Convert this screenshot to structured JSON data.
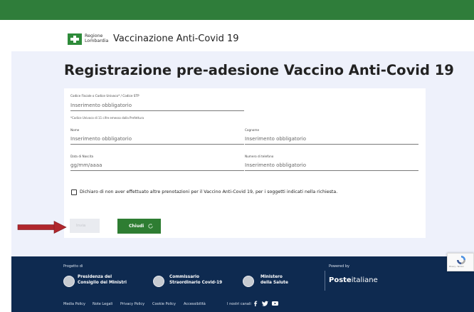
{
  "header": {
    "logo_line1": "Regione",
    "logo_line2": "Lombardia",
    "title": "Vaccinazione Anti-Covid 19"
  },
  "main": {
    "title": "Registrazione pre-adesione Vaccino Anti-Covid 19"
  },
  "form": {
    "codice_label": "Codice Fiscale o Codice Univoco* / Codice STP",
    "codice_placeholder": "Inserimento obbligatorio",
    "codice_hint": "*Codice Univoco di 11 cifre emesso dalla Prefettura",
    "nome_label": "Nome",
    "nome_placeholder": "Inserimento obbligatorio",
    "cognome_label": "Cognome",
    "cognome_placeholder": "Inserimento obbligatorio",
    "data_label": "Data di Nascita",
    "data_placeholder": "gg/mm/aaaa",
    "telefono_label": "Numero di telefono",
    "telefono_placeholder": "Inserimento obbligatorio",
    "checkbox_label": "Dichiaro di non aver effettuato altre prenotazioni per il Vaccino Anti-Covid 19, per i soggetti indicati nella richiesta.",
    "invia_label": "Invia",
    "chiudi_label": "Chiudi"
  },
  "footer": {
    "progetto_label": "Progetto di",
    "institutions": [
      {
        "line1": "Presidenza del",
        "line2": "Consiglio dei Ministri"
      },
      {
        "line1": "Commissario",
        "line2": "Straordinario Covid-19"
      },
      {
        "line1": "Ministero",
        "line2": "della Salute"
      }
    ],
    "powered_by": "Powered by",
    "poste_bold": "Poste",
    "poste_rest": "italiane",
    "links": [
      "Media Policy",
      "Note Legali",
      "Privacy Policy",
      "Cookie Policy",
      "Accessibilità"
    ],
    "social_label": "I nostri canali"
  },
  "recaptcha": {
    "text": "Privacy - Termini"
  },
  "colors": {
    "top_band": "#2f7d3a",
    "main_bg": "#eef1fb",
    "primary_button": "#2e7d32",
    "footer_bg": "#0e2a50",
    "arrow": "#b0262c"
  },
  "icons": [
    "regione-lombardia-logo-icon",
    "refresh-icon",
    "arrow-icon",
    "facebook-icon",
    "twitter-icon",
    "youtube-icon",
    "recaptcha-icon"
  ]
}
